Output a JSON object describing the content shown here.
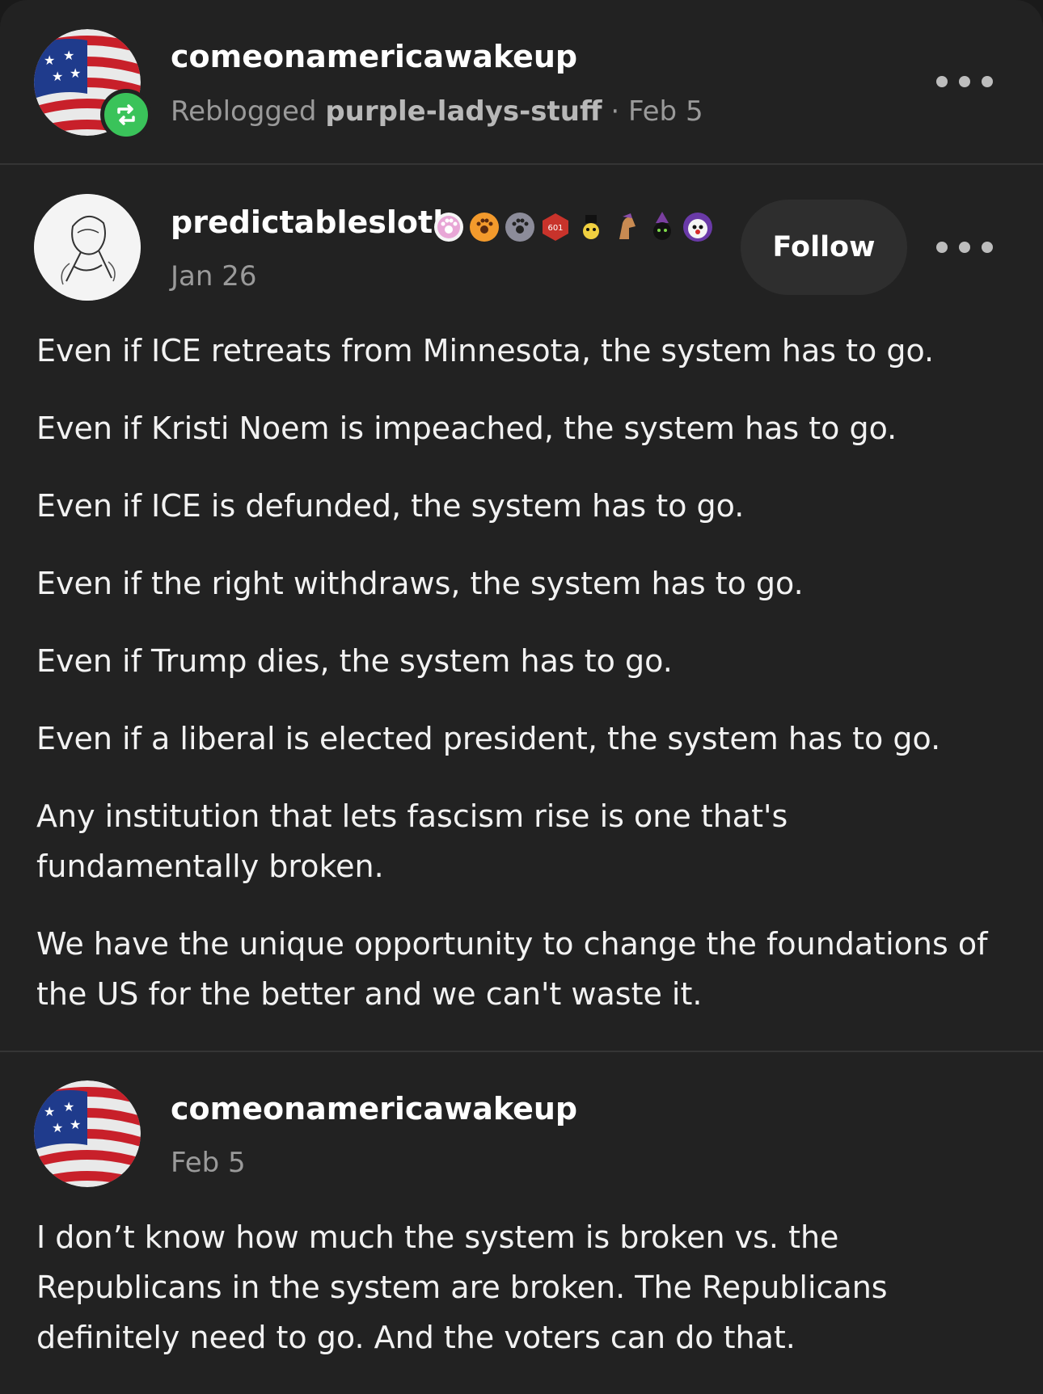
{
  "reblog_header": {
    "username": "comeonamericawakeup",
    "reblogged_prefix": "Reblogged",
    "reblogged_from": "purple-ladys-stuff",
    "separator": "·",
    "date": "Feb 5",
    "avatar_icon": "us-flag-avatar",
    "reblog_icon": "reblog-icon",
    "more_icon": "more-dots-icon"
  },
  "original_post": {
    "username": "predictablesloth",
    "date": "Jan 26",
    "follow_label": "Follow",
    "avatar_icon": "sketch-portrait-avatar",
    "badges": [
      "paw-badge-pink",
      "paw-badge-orange",
      "paw-badge-gray",
      "d20-badge",
      "penguin-badge",
      "horse-badge",
      "witch-cat-badge",
      "clown-badge"
    ],
    "paragraphs": [
      "Even if ICE retreats from Minnesota, the system has to go.",
      "Even if Kristi Noem is impeached, the system has to go.",
      "Even if ICE is defunded, the system has to go.",
      "Even if the right withdraws, the system has to go.",
      "Even if Trump dies, the system has to go.",
      "Even if a liberal is elected president, the system has to go.",
      "Any institution that lets fascism rise is one that's fundamentally broken.",
      "We have the unique opportunity to change the foundations of the US for the better and we can't waste it."
    ]
  },
  "reply_post": {
    "username": "comeonamericawakeup",
    "date": "Feb 5",
    "avatar_icon": "us-flag-avatar",
    "paragraphs": [
      "I don’t know how much the system is broken vs. the Republicans in the system are broken. The Republicans definitely need to go. And the voters can do that."
    ]
  },
  "colors": {
    "background": "#222222",
    "reblog_green": "#3ac35a",
    "text": "#f2f2f2",
    "muted": "#9a9a9a"
  }
}
